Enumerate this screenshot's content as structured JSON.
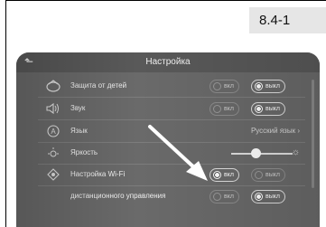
{
  "section_tag": "8.4-1",
  "screen": {
    "title": "Настройка",
    "rows": [
      {
        "label": "Защита от детей",
        "icon": "child-lock-icon",
        "on": "вкл",
        "off": "выкл",
        "selected": "off"
      },
      {
        "label": "Звук",
        "icon": "speaker-icon",
        "on": "вкл",
        "off": "выкл",
        "selected": "off"
      },
      {
        "label": "Язык",
        "icon": "language-icon",
        "value": "Русский язык"
      },
      {
        "label": "Яркость",
        "icon": "brightness-icon",
        "level": 0.4
      },
      {
        "label": "Настройка Wi-Fi",
        "icon": "wifi-settings-icon",
        "on": "вкл",
        "off": "выкл",
        "selected": "on"
      },
      {
        "label": "дистанционного управления",
        "on": "вкл",
        "off": "выкл",
        "selected": "off"
      }
    ]
  }
}
